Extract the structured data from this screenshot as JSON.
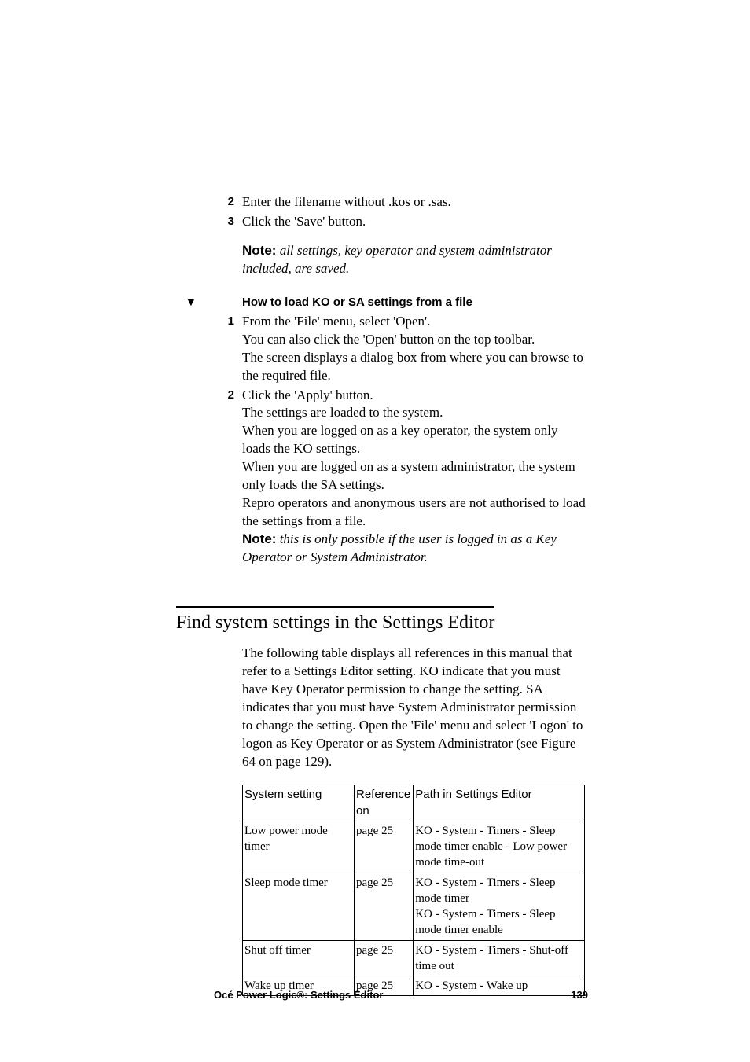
{
  "steps_top": [
    {
      "num": "2",
      "text": "Enter the filename without .kos or .sas."
    },
    {
      "num": "3",
      "text": "Click the 'Save' button."
    }
  ],
  "note1": {
    "label": "Note:",
    "text": " all settings, key operator and system administrator included, are saved."
  },
  "proc_marker": "▼",
  "proc_heading": "How to load KO or SA settings from a file",
  "steps_proc": [
    {
      "num": "1",
      "lines": [
        "From the 'File' menu, select 'Open'.",
        "You can also click the 'Open' button on the top toolbar.",
        "The screen displays a dialog box from where you can browse to the required file."
      ]
    },
    {
      "num": "2",
      "lines": [
        "Click the 'Apply' button.",
        "The settings are loaded to the system.",
        "When you are logged on as a key operator, the system only loads the KO settings.",
        "When you are logged on as a system administrator, the system only loads the SA settings.",
        "Repro operators and anonymous users are not authorised to load the settings from a file."
      ]
    }
  ],
  "note2": {
    "label": "Note:",
    "text": " this is only possible if the user is logged in as a Key Operator or System Administrator."
  },
  "heading2": "Find system settings in the Settings Editor",
  "intro_para": "The following table displays all references in this manual that refer to a Settings Editor setting. KO indicate that you must have Key Operator permission to change the setting. SA indicates that you must have System Administrator permission to change the setting. Open the 'File' menu and select 'Logon' to logon as Key Operator or as System Administrator (see Figure 64 on page 129).",
  "table": {
    "headers": [
      "System setting",
      "Reference on",
      "Path in Settings Editor"
    ],
    "rows": [
      {
        "c1": "Low power mode timer",
        "c2": "page 25",
        "c3": "KO - System - Timers - Sleep mode timer enable - Low power mode time-out"
      },
      {
        "c1": "Sleep mode timer",
        "c2": "page 25",
        "c3": "KO - System - Timers - Sleep mode timer\nKO - System - Timers - Sleep mode timer enable"
      },
      {
        "c1": "Shut off timer",
        "c2": "page 25",
        "c3": "KO - System - Timers - Shut-off time out"
      },
      {
        "c1": "Wake up timer",
        "c2": "page 25",
        "c3": "KO - System - Wake up"
      }
    ]
  },
  "footer": {
    "left": "Océ Power Logic®: Settings Editor",
    "right": "139"
  }
}
